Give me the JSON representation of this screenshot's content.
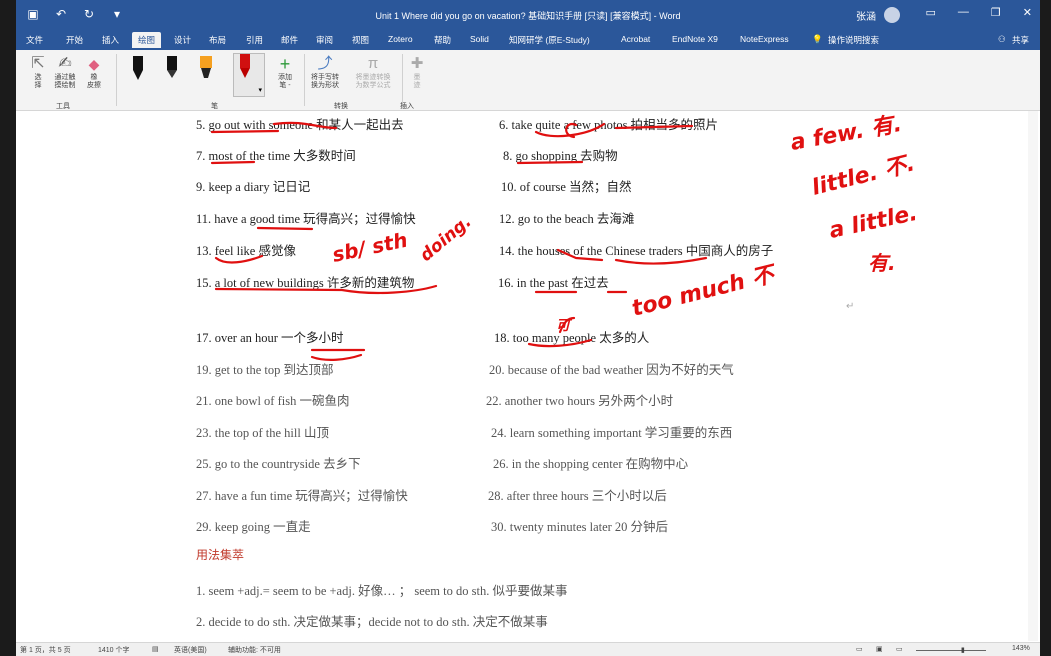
{
  "window": {
    "title": "Unit 1 Where did you go on vacation? 基础知识手册 [只读] [兼容模式] - Word",
    "user": "张涵",
    "controls": [
      "▭",
      "—",
      "❐",
      "✕"
    ]
  },
  "qat": {
    "save_icon": "save-icon",
    "undo_icon": "undo-icon",
    "redo_icon": "redo-icon",
    "more_icon": "customize-icon"
  },
  "tabs": [
    "文件",
    "开始",
    "插入",
    "绘图",
    "设计",
    "布局",
    "引用",
    "邮件",
    "审阅",
    "视图",
    "Zotero",
    "帮助",
    "Solid",
    "知网研学 (原E-Study)",
    "Acrobat",
    "EndNote X9",
    "NoteExpress",
    "操作说明搜索",
    "共享"
  ],
  "active_tab": "绘图",
  "ribbon": {
    "tools": [
      {
        "label": "选\n择",
        "icon": "cursor-icon"
      },
      {
        "label": "通过触\n摸绘制",
        "icon": "touch-draw-icon"
      },
      {
        "label": "橡\n皮擦",
        "icon": "eraser-icon"
      }
    ],
    "tools_group": "工具",
    "pens_group": "笔",
    "add_pen": "添加\n笔 -",
    "convert": "将手写转\n换为形状",
    "convert2": "将墨迹转换\n为数学公式",
    "convert_group": "转换",
    "insert": "墨\n迹",
    "insert_group": "插入"
  },
  "doc": {
    "rows": [
      {
        "left": "5. go out with someone  和某人一起出去",
        "right": "6. take quite a few photos  拍相当多的照片"
      },
      {
        "left": "7. most of the time  大多数时间",
        "right": "8. go shopping  去购物"
      },
      {
        "left": "9. keep a diary  记日记",
        "right": "10. of course  当然；自然"
      },
      {
        "left": "11. have a good time  玩得高兴；过得愉快",
        "right": "12. go to the beach  去海滩"
      },
      {
        "left": "13. feel like  感觉像",
        "right": "14. the houses of the Chinese traders  中国商人的房子"
      },
      {
        "left": "15. a lot of new buildings  许多新的建筑物",
        "right": "16. in the past  在过去"
      },
      {
        "left": "17. over an hour  一个多小时",
        "right": "18. too many people  太多的人"
      },
      {
        "left": "19. get to the top  到达顶部",
        "right": "20. because of the bad weather  因为不好的天气"
      },
      {
        "left": "21. one bowl of fish  一碗鱼肉",
        "right": "22. another two hours  另外两个小时"
      },
      {
        "left": "23. the top of the hill  山顶",
        "right": "24. learn something important  学习重要的东西"
      },
      {
        "left": "25. go to the countryside  去乡下",
        "right": "26. in the shopping center  在购物中心"
      },
      {
        "left": "27. have a fun time  玩得高兴；过得愉快",
        "right": "28. after three hours  三个小时以后"
      },
      {
        "left": "29. keep going  一直走",
        "right": "30. twenty minutes later  20 分钟后"
      }
    ],
    "section_title": "用法集萃",
    "usage": [
      "1. seem +adj.= seem to be +adj.  好像… ；  seem to do sth.  似乎要做某事",
      "2. decide to do sth.  决定做某事；decide not to do sth.  决定不做某事"
    ],
    "para_mark": "↵"
  },
  "ink": {
    "a_few": "a few. 有.",
    "little": "little. 不.",
    "a_little": "a little.",
    "you": "有.",
    "sb_sth": "sb/ sth",
    "doing": "doing.",
    "too_much": "too much 不",
    "many_mark": "可"
  },
  "status": {
    "page": "第 1 页，共 5 页",
    "words": "1410 个字",
    "lang": "英语(美国)",
    "access": "辅助功能: 不可用",
    "zoom": "143%"
  }
}
